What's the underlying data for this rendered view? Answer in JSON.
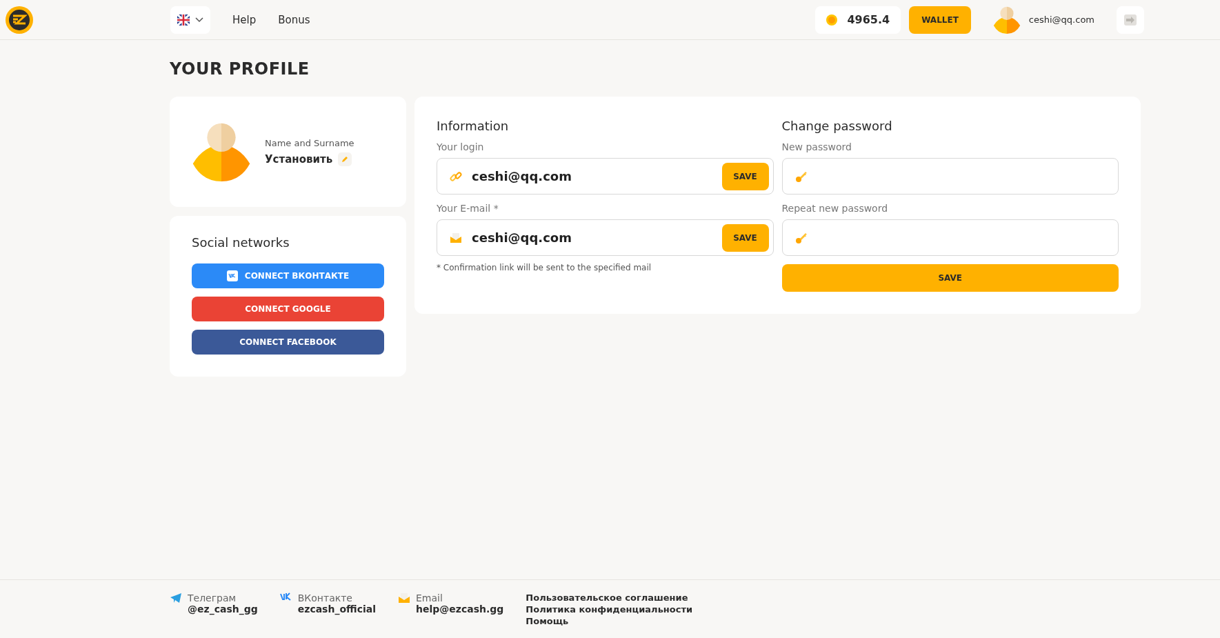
{
  "header": {
    "nav": [
      "Help",
      "Bonus"
    ],
    "balance": "4965.4",
    "wallet_button": "WALLET",
    "user_email": "ceshi@qq.com"
  },
  "page_title": "YOUR PROFILE",
  "profile": {
    "name_label": "Name and Surname",
    "name_value": "Установить"
  },
  "social": {
    "title": "Social networks",
    "buttons": [
      {
        "kind": "vk",
        "label": "CONNECT ВКОНТАКТЕ",
        "color": "#2b8af7"
      },
      {
        "kind": "google",
        "label": "CONNECT GOOGLE",
        "color": "#ea4335"
      },
      {
        "kind": "facebook",
        "label": "CONNECT FACEBOOK",
        "color": "#3b5998"
      }
    ]
  },
  "information": {
    "title": "Information",
    "fields": [
      {
        "kind": "login",
        "label": "Your login",
        "value": "ceshi@qq.com",
        "button": "SAVE"
      },
      {
        "kind": "email",
        "label": "Your E-mail *",
        "value": "ceshi@qq.com",
        "button": "SAVE"
      }
    ],
    "note": "* Confirmation link will be sent to the specified mail"
  },
  "password": {
    "title": "Change password",
    "fields": [
      {
        "label": "New password"
      },
      {
        "label": "Repeat new password"
      }
    ],
    "button": "SAVE"
  },
  "footer": {
    "contacts": [
      {
        "kind": "telegram",
        "label": "Телеграм",
        "value": "@ez_cash_gg"
      },
      {
        "kind": "vk",
        "label": "ВКонтакте",
        "value": "ezcash_official"
      },
      {
        "kind": "email",
        "label": "Email",
        "value": "help@ezcash.gg"
      }
    ],
    "links": [
      "Пользовательское соглашение",
      "Политика конфиденциальности",
      "Помощь"
    ]
  }
}
